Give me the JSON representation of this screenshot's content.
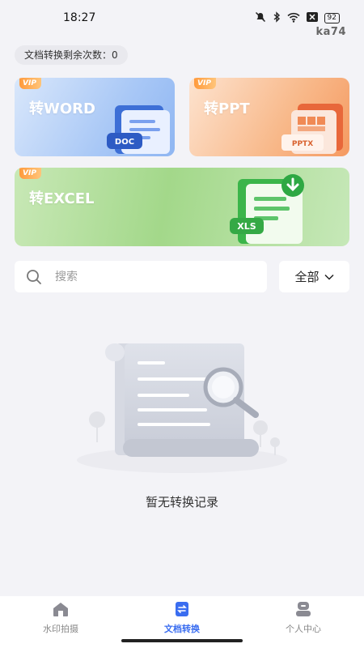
{
  "status_bar": {
    "time": "18:27",
    "battery": "92",
    "icons": [
      "mute-icon",
      "bluetooth-icon",
      "wifi-icon",
      "sim-icon",
      "battery-icon"
    ]
  },
  "watermark": "ka74",
  "remaining_label": "文档转换剩余次数：0",
  "cards": {
    "word": {
      "badge": "VIP",
      "title": "转WORD",
      "file_tag": "DOC"
    },
    "ppt": {
      "badge": "VIP",
      "title": "转PPT",
      "file_tag": "PPTX"
    },
    "excel": {
      "badge": "VIP",
      "title": "转EXCEL",
      "file_tag": "XLS"
    }
  },
  "search": {
    "placeholder": "搜索"
  },
  "filter": {
    "selected": "全部"
  },
  "empty_state": {
    "text": "暂无转换记录"
  },
  "tabs": [
    {
      "label": "水印拍摄",
      "icon": "home-icon",
      "active": false
    },
    {
      "label": "文档转换",
      "icon": "convert-doc-icon",
      "active": true
    },
    {
      "label": "个人中心",
      "icon": "profile-icon",
      "active": false
    }
  ],
  "colors": {
    "accent": "#3a6df0",
    "word_card": "#a9c8f6",
    "ppt_card": "#f8b889",
    "excel_card": "#a3d88a",
    "background": "#f3f3f7"
  }
}
